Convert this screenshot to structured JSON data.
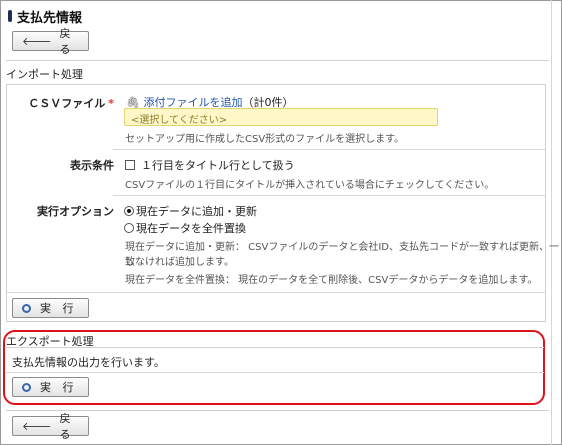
{
  "page": {
    "title": "支払先情報",
    "back_label": "戻 る"
  },
  "import": {
    "section_label": "インポート処理",
    "csv": {
      "label": "ＣＳＶファイル",
      "required_mark": "*",
      "attach_link": "添付ファイルを追加",
      "attach_count": "（計0件）",
      "placeholder": "<選択してください>",
      "note": "セットアップ用に作成したCSV形式のファイルを選択します。"
    },
    "display": {
      "label": "表示条件",
      "checkbox_label": "１行目をタイトル行として扱う",
      "note": "CSVファイルの１行目にタイトルが挿入されている場合にチェックしてください。"
    },
    "option": {
      "label": "実行オプション",
      "radio1": "現在データに追加・更新",
      "radio2": "現在データを全件置換",
      "note1": "現在データに追加・更新：  CSVファイルのデータと会社ID、支払先コードが一致すれば更新、一致",
      "note2": "しなければ追加します。",
      "note3": "現在データを全件置換：  現在のデータを全て削除後、CSVデータからデータを追加します。",
      "selected": "現在データに追加・更新"
    },
    "run_label": "実 行"
  },
  "export": {
    "section_label": "エクスポート処理",
    "description": "支払先情報の出力を行います。",
    "run_label": "実 行"
  }
}
